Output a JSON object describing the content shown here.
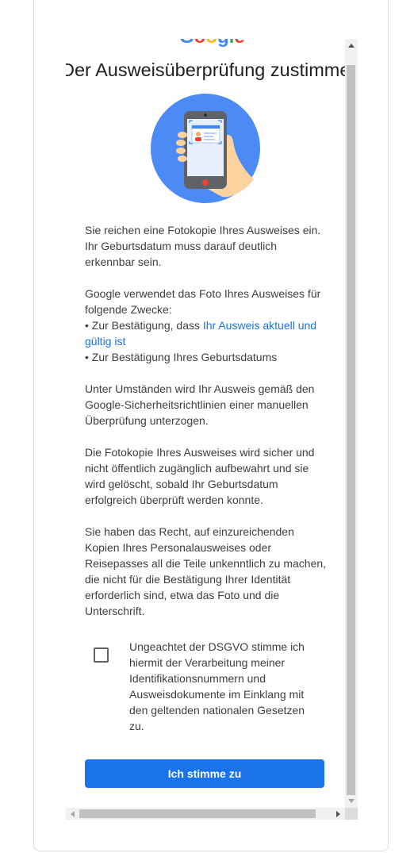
{
  "logo": {
    "text": "Google"
  },
  "page": {
    "title": "Der Ausweisüberprüfung zustimmen"
  },
  "illustration": {
    "icon": "phone-id-scan-icon",
    "circle_color": "#4c8bf5"
  },
  "body": {
    "p1": "Sie reichen eine Fotokopie Ihres Ausweises ein. Ihr Geburtsdatum muss darauf deutlich erkennbar sein.",
    "p2_intro": "Google verwendet das Foto Ihres Ausweises für folgende Zwecke:",
    "bullet1_prefix": "• Zur Bestätigung, dass ",
    "bullet1_link": "Ihr Ausweis aktuell und gültig ist",
    "bullet2": "• Zur Bestätigung Ihres Geburtsdatums",
    "p3": "Unter Umständen wird Ihr Ausweis gemäß den Google-Sicherheitsrichtlinien einer manuellen Überprüfung unterzogen.",
    "p4": "Die Fotokopie Ihres Ausweises wird sicher und nicht öffentlich zugänglich aufbewahrt und sie wird gelöscht, sobald Ihr Geburtsdatum erfolgreich überprüft werden konnte.",
    "p5": "Sie haben das Recht, auf einzureichenden Kopien Ihres Personalausweises oder Reisepasses all die Teile unkenntlich zu machen, die nicht für die Bestätigung Ihrer Identität erforderlich sind, etwa das Foto und die Unterschrift."
  },
  "consent": {
    "checked": false,
    "label": "Ungeachtet der DSGVO stimme ich hiermit der Verarbeitung meiner Identifikationsnummern und Ausweisdokumente im Einklang mit den geltenden nationalen Gesetzen zu."
  },
  "actions": {
    "agree_label": "Ich stimme zu"
  },
  "colors": {
    "primary": "#1a73e8",
    "link": "#1a73e8",
    "text": "#3c4043"
  }
}
